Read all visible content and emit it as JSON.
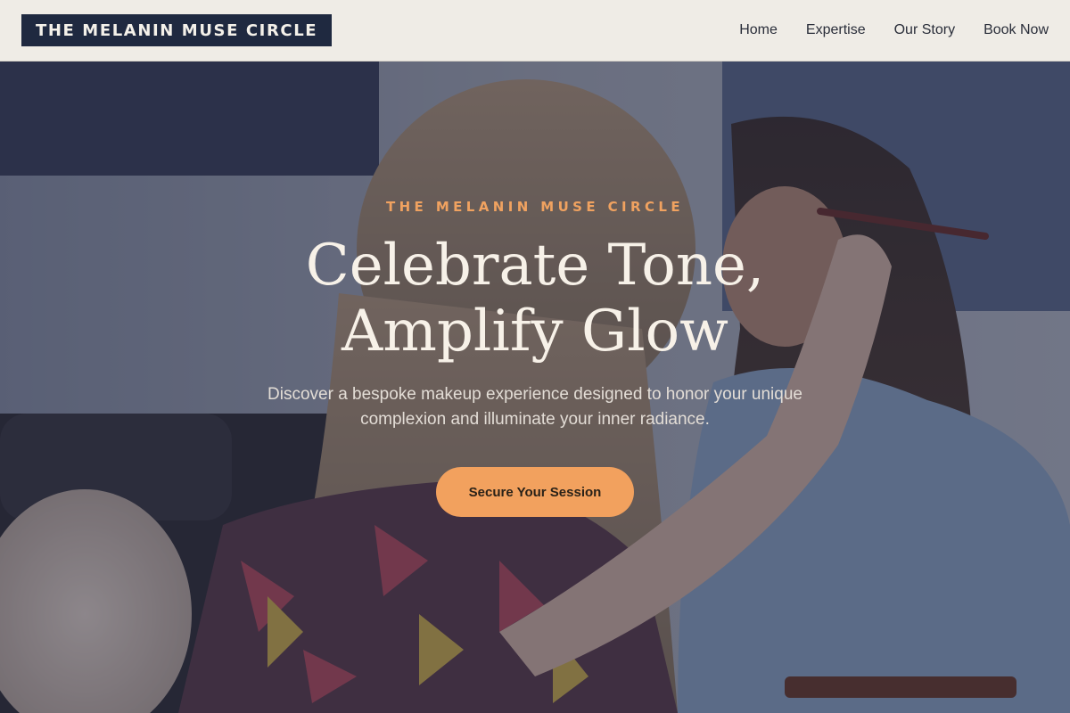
{
  "brand": {
    "logo_text": "THE MELANIN MUSE CIRCLE"
  },
  "nav": {
    "items": [
      "Home",
      "Expertise",
      "Our Story",
      "Book Now"
    ]
  },
  "hero": {
    "eyebrow": "THE MELANIN MUSE CIRCLE",
    "headline_line1": "Celebrate Tone,",
    "headline_line2": "Amplify Glow",
    "subtext": "Discover a bespoke makeup experience designed to honor your unique complexion and illuminate your inner radiance.",
    "cta_label": "Secure Your Session"
  },
  "colors": {
    "header_bg": "#efece6",
    "logo_bg": "#1f2940",
    "accent": "#f2a15e",
    "overlay": "#1c2137"
  }
}
